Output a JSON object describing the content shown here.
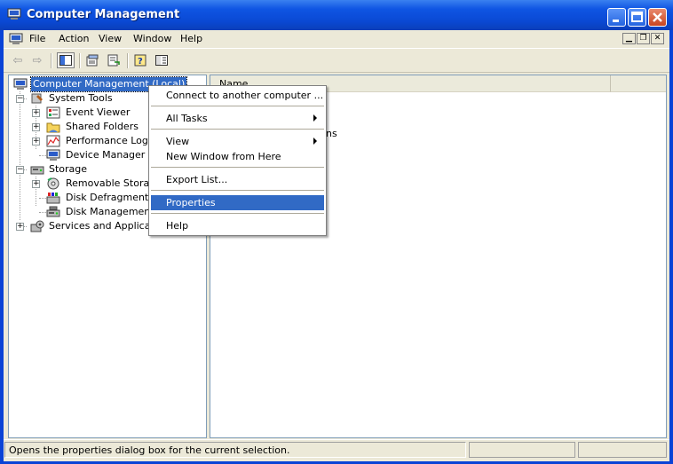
{
  "window": {
    "title": "Computer Management"
  },
  "menubar": {
    "items": [
      "File",
      "Action",
      "View",
      "Window",
      "Help"
    ]
  },
  "tree": {
    "root": "Computer Management (Local)",
    "system_tools": "System Tools",
    "event_viewer": "Event Viewer",
    "shared_folders": "Shared Folders",
    "perf_logs": "Performance Logs a",
    "device_manager": "Device Manager",
    "storage": "Storage",
    "removable_storage": "Removable Storage",
    "disk_defrag": "Disk Defragmenter",
    "disk_mgmt": "Disk Management",
    "services": "Services and Applicatio"
  },
  "list": {
    "column_name": "Name",
    "partial_row": "ns"
  },
  "context_menu": {
    "connect": "Connect to another computer ...",
    "all_tasks": "All Tasks",
    "view": "View",
    "new_window": "New Window from Here",
    "export": "Export List...",
    "properties": "Properties",
    "help": "Help"
  },
  "status": {
    "text": "Opens the properties dialog box for the current selection."
  }
}
